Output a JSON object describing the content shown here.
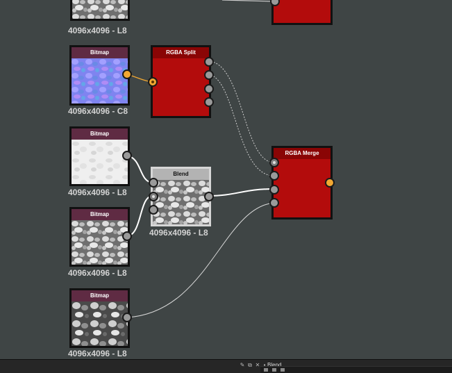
{
  "colors": {
    "background": "#3f4545",
    "bitmap_header": "#5f2b43",
    "rgba_node": "#b30c0c",
    "orange_port": "#f2a832",
    "connection_white": "#ffffff",
    "connection_dotted": "#c9c9c9"
  },
  "nodes": {
    "top_bitmap": {
      "caption": "4096x4096 - L8"
    },
    "normal_bitmap": {
      "title": "Bitmap",
      "caption": "4096x4096 - C8"
    },
    "rgba_split": {
      "title": "RGBA Split"
    },
    "bitmap_white": {
      "title": "Bitmap",
      "caption": "4096x4096 - L8"
    },
    "blend": {
      "title": "Blend",
      "caption": "4096x4096 - L8"
    },
    "bitmap_stones": {
      "title": "Bitmap",
      "caption": "4096x4096 - L8"
    },
    "rgba_merge": {
      "title": "RGBA Merge"
    },
    "bitmap_dark": {
      "title": "Bitmap",
      "caption": "4096x4096 - L8"
    }
  },
  "statusbar": {
    "title": "Blend",
    "icons": [
      "pin-icon",
      "undock-icon",
      "close-icon"
    ]
  }
}
